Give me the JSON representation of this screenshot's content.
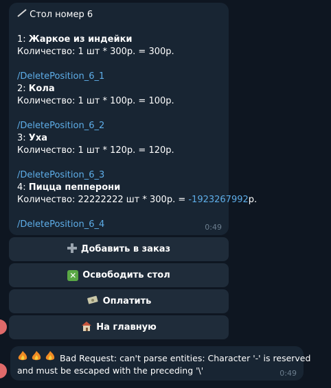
{
  "message1": {
    "title_icon": "pencil-icon",
    "title": "Стол номер 6",
    "positions": [
      {
        "num": "1: ",
        "name": "Жаркое из индейки",
        "qty": "Количество: 1 шт * 300р. = 300р.",
        "delete": "/DeletePosition_6_1"
      },
      {
        "num": "2: ",
        "name": "Кола",
        "qty": "Количество: 1 шт * 100р. = 100р.",
        "delete": "/DeletePosition_6_2"
      },
      {
        "num": "3: ",
        "name": "Уха",
        "qty": "Количество: 1 шт * 120р. = 120р.",
        "delete": "/DeletePosition_6_3"
      },
      {
        "num": "4: ",
        "name": "Пицца пепперони",
        "qty_prefix": "Количество: 22222222 шт * 300р. = ",
        "qty_neg": "-1923267992",
        "qty_suffix": "р.",
        "delete": "/DeletePosition_6_4"
      }
    ],
    "time": "0:49"
  },
  "buttons": {
    "add": {
      "icon": "plus-icon",
      "label": "Добавить в заказ"
    },
    "free": {
      "icon": "cross-mark-icon",
      "label": "Освободить стол"
    },
    "pay": {
      "icon": "money-icon",
      "label": "Оплатить"
    },
    "home": {
      "icon": "house-icon",
      "label": "На главную"
    }
  },
  "message2": {
    "icons": "fire-icon",
    "line1": "Bad Request: can't parse entities: Character '-' is reserved",
    "line2": "and must be escaped with the preceding '\\'",
    "time": "0:49"
  },
  "colors": {
    "background": "#0e1621",
    "bubble": "#182533",
    "button": "#1f2c3a",
    "link": "#5eaee9"
  }
}
